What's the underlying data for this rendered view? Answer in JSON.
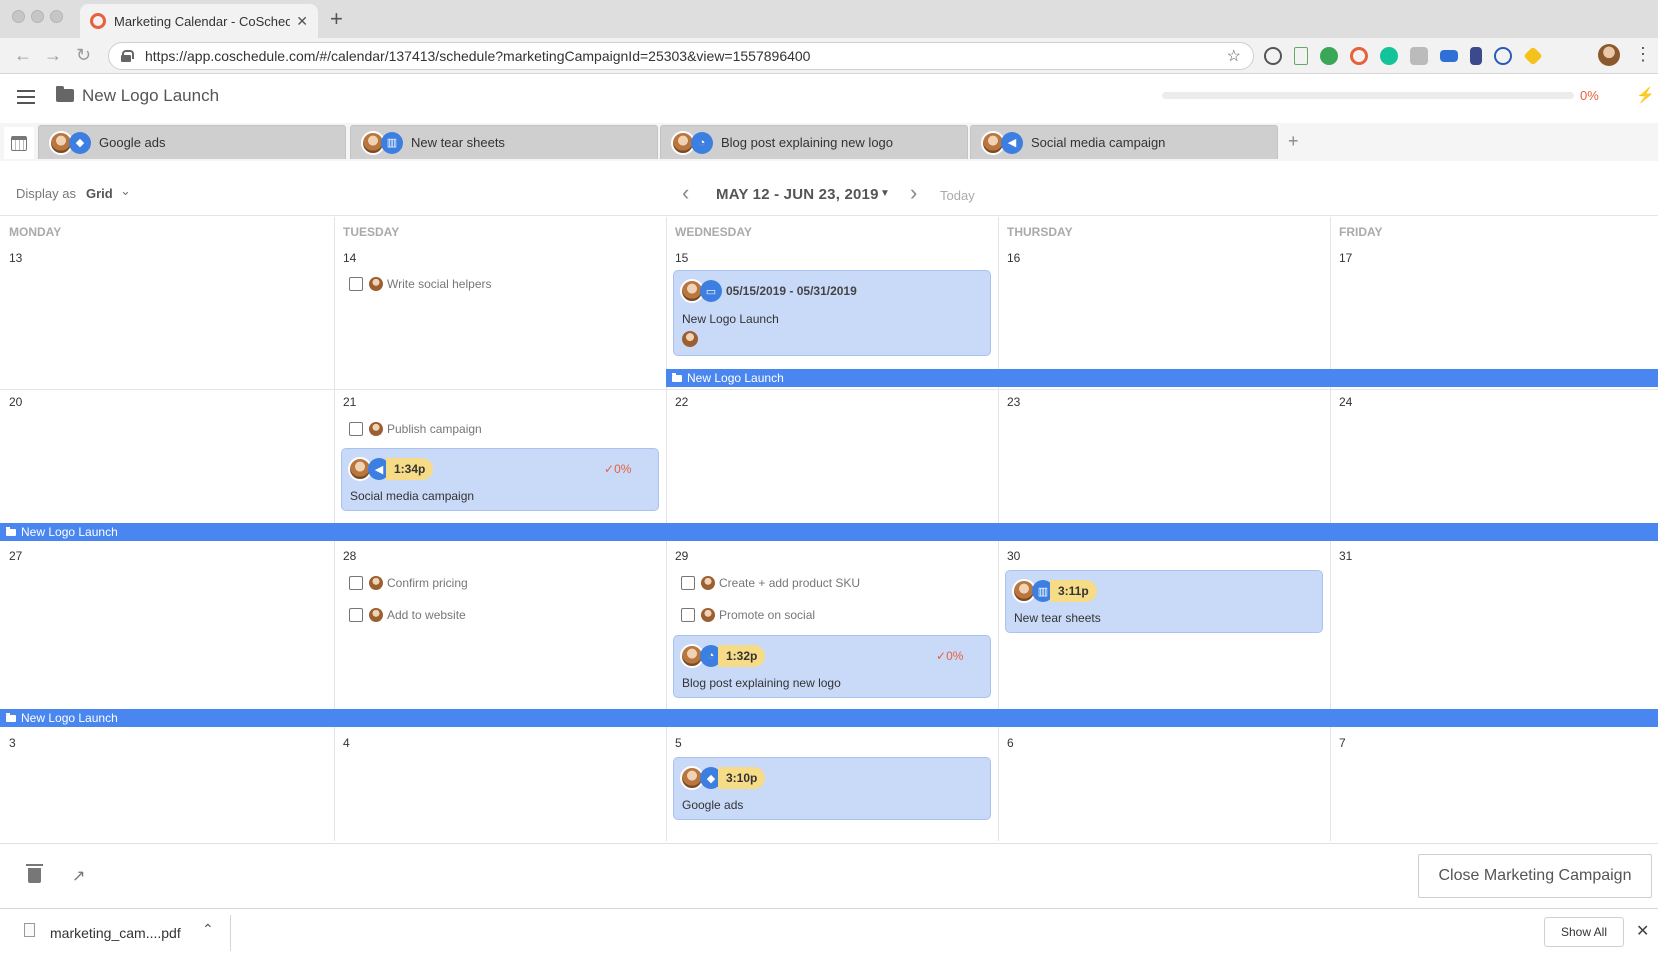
{
  "browser": {
    "tab_title": "Marketing Calendar - CoSchedule",
    "url": "https://app.coschedule.com/#/calendar/137413/schedule?marketingCampaignId=25303&view=1557896400"
  },
  "header": {
    "campaign_title": "New Logo Launch",
    "progress_label": "0%",
    "progress": 0
  },
  "tabs": [
    {
      "label": "Google ads",
      "icon": "tag-icon"
    },
    {
      "label": "New tear sheets",
      "icon": "map-icon"
    },
    {
      "label": "Blog post explaining new logo",
      "icon": "rss-icon"
    },
    {
      "label": "Social media campaign",
      "icon": "megaphone-icon"
    }
  ],
  "toolbar": {
    "display_as_label": "Display as",
    "display_value": "Grid",
    "date_range": "MAY 12 - JUN 23, 2019",
    "today_label": "Today"
  },
  "weekdays": [
    "MONDAY",
    "TUESDAY",
    "WEDNESDAY",
    "THURSDAY",
    "FRIDAY"
  ],
  "weeks": [
    {
      "days": [
        "13",
        "14",
        "15",
        "16",
        "17"
      ]
    },
    {
      "days": [
        "20",
        "21",
        "22",
        "23",
        "24"
      ]
    },
    {
      "days": [
        "27",
        "28",
        "29",
        "30",
        "31"
      ]
    },
    {
      "days": [
        "3",
        "4",
        "5",
        "6",
        "7"
      ]
    }
  ],
  "tasks": {
    "write_social_helpers": "Write social helpers",
    "publish_campaign": "Publish campaign",
    "confirm_pricing": "Confirm pricing",
    "add_to_website": "Add to website",
    "create_product_sku": "Create + add product SKU",
    "promote_on_social": "Promote on social"
  },
  "cards": {
    "campaign": {
      "range": "05/15/2019 - 05/31/2019",
      "title": "New Logo Launch"
    },
    "social": {
      "time": "1:34p",
      "title": "Social media campaign",
      "pct": "0%"
    },
    "blog": {
      "time": "1:32p",
      "title": "Blog post explaining new logo",
      "pct": "0%"
    },
    "tear": {
      "time": "3:11p",
      "title": "New tear sheets"
    },
    "google": {
      "time": "3:10p",
      "title": "Google ads"
    }
  },
  "campaign_bar_label": "New Logo Launch",
  "footer": {
    "close_label": "Close Marketing Campaign"
  },
  "downloads": {
    "file_name": "marketing_cam....pdf",
    "show_all": "Show All"
  },
  "colors": {
    "accent": "#4a86f0",
    "card_bg": "#c9daf8",
    "time_chip": "#f7dc88",
    "progress_text": "#e8603c"
  }
}
